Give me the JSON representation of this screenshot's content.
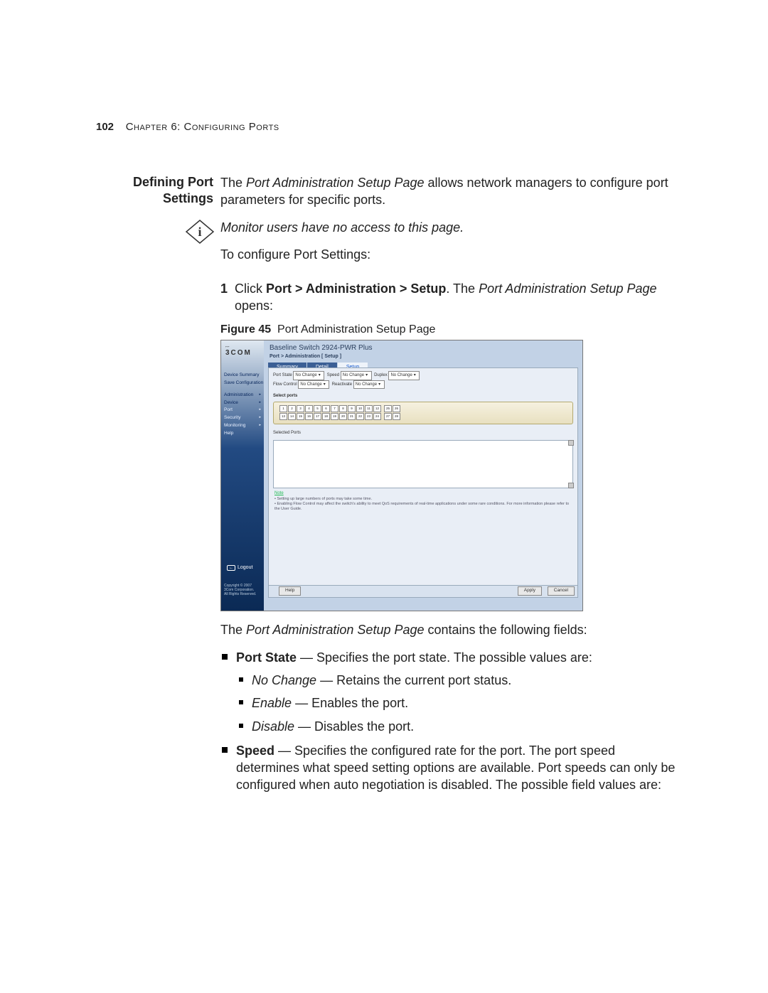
{
  "page": {
    "number": "102",
    "chapter_label": "Chapter 6: Configuring Ports"
  },
  "side_heading": "Defining Port Settings",
  "intro": {
    "pre": "The ",
    "em": "Port Administration Setup Page",
    "post": " allows network managers to configure port parameters for specific ports."
  },
  "info_note": "Monitor users have no access to this page.",
  "lead_in": "To configure Port Settings:",
  "step1": {
    "num": "1",
    "pre": "Click ",
    "bold": "Port > Administration > Setup",
    "mid": ". The ",
    "em": "Port Administration Setup Page",
    "post": " opens:"
  },
  "figure": {
    "label": "Figure 45",
    "caption": "Port Administration Setup Page"
  },
  "screenshot": {
    "logo": "3COM",
    "title": "Baseline Switch 2924-PWR Plus",
    "breadcrumb": "Port > Administration [ Setup ]",
    "tabs": [
      "Summary",
      "Detail",
      "Setup"
    ],
    "menu": [
      "Device Summary",
      "Save Configuration",
      "Administration",
      "Device",
      "Port",
      "Security",
      "Monitoring",
      "Help"
    ],
    "fields": {
      "port_state_label": "Port State",
      "port_state_value": "No Change",
      "speed_label": "Speed",
      "speed_value": "No Change",
      "duplex_label": "Duplex",
      "duplex_value": "No Change",
      "flow_label": "Flow Control",
      "flow_value": "No Change",
      "react_label": "Reactivate",
      "react_value": "No Change"
    },
    "select_ports_label": "Select ports",
    "ports_top": [
      "1",
      "2",
      "3",
      "4",
      "5",
      "6",
      "7",
      "8",
      "9",
      "10",
      "11",
      "12"
    ],
    "ports_bot": [
      "13",
      "14",
      "15",
      "16",
      "17",
      "18",
      "19",
      "20",
      "21",
      "22",
      "23",
      "24"
    ],
    "ports_r_top": [
      "25",
      "26"
    ],
    "ports_r_bot": [
      "27",
      "28"
    ],
    "selected_label": "Selected Ports",
    "note_head": "Note",
    "note1": "Setting up large numbers of ports may take some time.",
    "note2": "Enabling Flow Control may affect the switch's ability to meet QoS requirements of real-time applications under some rare conditions. For more information please refer to the User Guide.",
    "logout": "Logout",
    "copyright": "Copyright © 2007\n3Com Corporation.\nAll Rights Reserved.",
    "btn_help": "Help",
    "btn_apply": "Apply",
    "btn_cancel": "Cancel"
  },
  "after_fig": {
    "pre": "The ",
    "em": "Port Administration Setup Page",
    "post": " contains the following fields:"
  },
  "fields_list": {
    "port_state": {
      "name": "Port State",
      "desc": " — Specifies the port state. The possible values are:",
      "opts": [
        {
          "name": "No Change",
          "desc": " — Retains the current port status."
        },
        {
          "name": "Enable",
          "desc": " — Enables the port."
        },
        {
          "name": "Disable",
          "desc": " — Disables the port."
        }
      ]
    },
    "speed": {
      "name": "Speed",
      "desc": " — Specifies the configured rate for the port. The port speed determines what speed setting options are available. Port speeds can only be configured when auto negotiation is disabled. The possible field values are:"
    }
  }
}
